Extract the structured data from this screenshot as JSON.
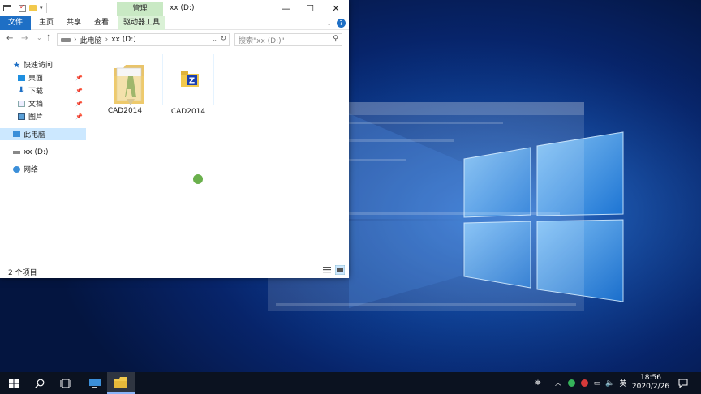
{
  "window": {
    "title": "xx (D:)",
    "context_tab": "管理",
    "controls": {
      "minimize": "—",
      "maximize": "☐",
      "close": "✕"
    }
  },
  "ribbon": {
    "tabs": [
      {
        "label": "文件"
      },
      {
        "label": "主页"
      },
      {
        "label": "共享"
      },
      {
        "label": "查看"
      },
      {
        "label": "驱动器工具"
      }
    ],
    "help": "?"
  },
  "address": {
    "crumb_1": "此电脑",
    "crumb_2": "xx (D:)",
    "search_placeholder": "搜索\"xx (D:)\""
  },
  "nav_pane": {
    "quick_access": "快速访问",
    "items": [
      {
        "label": "桌面"
      },
      {
        "label": "下载"
      },
      {
        "label": "文档"
      },
      {
        "label": "图片"
      }
    ],
    "this_pc": "此电脑",
    "drive": "xx (D:)",
    "network": "网络"
  },
  "files": [
    {
      "name": "CAD2014"
    },
    {
      "name": "CAD2014"
    }
  ],
  "status": {
    "count": "2 个项目"
  },
  "taskbar": {
    "tray_ime": "英",
    "time": "18:56",
    "date": "2020/2/26"
  },
  "colors": {
    "accent": "#1e6fc5",
    "context_tab": "#c9e9c4",
    "selection": "#cce8ff",
    "taskbar": "#0b1220"
  }
}
